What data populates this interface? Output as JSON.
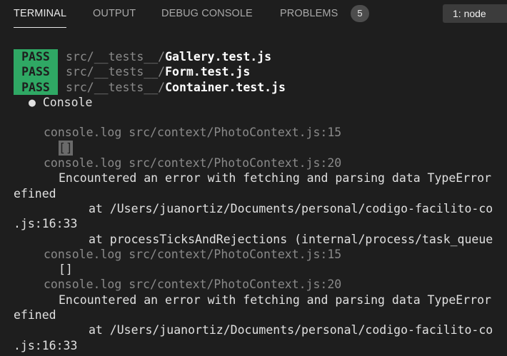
{
  "tabs": [
    {
      "label": "TERMINAL",
      "active": true
    },
    {
      "label": "OUTPUT",
      "active": false
    },
    {
      "label": "DEBUG CONSOLE",
      "active": false
    },
    {
      "label": "PROBLEMS",
      "active": false
    }
  ],
  "problems_count": "5",
  "terminal_selector": "1: node",
  "pass_label": "PASS",
  "results": [
    {
      "dir": "src/__tests__/",
      "file": "Gallery.test.js"
    },
    {
      "dir": "src/__tests__/",
      "file": "Form.test.js"
    },
    {
      "dir": "src/__tests__/",
      "file": "Container.test.js"
    }
  ],
  "console_header": "● Console",
  "log1": "console.log src/context/PhotoContext.js:15",
  "empty_array": "[]",
  "log2": "console.log src/context/PhotoContext.js:20",
  "error_msg": "Encountered an error with fetching and parsing data TypeError",
  "efined": "efined",
  "at1": "at /Users/juanortiz/Documents/personal/codigo-facilito-co",
  "js_line": ".js:16:33",
  "at2": "at processTicksAndRejections (internal/process/task_queue",
  "log3": "console.log src/context/PhotoContext.js:15",
  "empty_array2": "[]",
  "log4": "console.log src/context/PhotoContext.js:20",
  "error_msg2": "Encountered an error with fetching and parsing data TypeError",
  "efined2": "efined",
  "at3": "at /Users/juanortiz/Documents/personal/codigo-facilito-co",
  "js_line2": ".js:16:33"
}
